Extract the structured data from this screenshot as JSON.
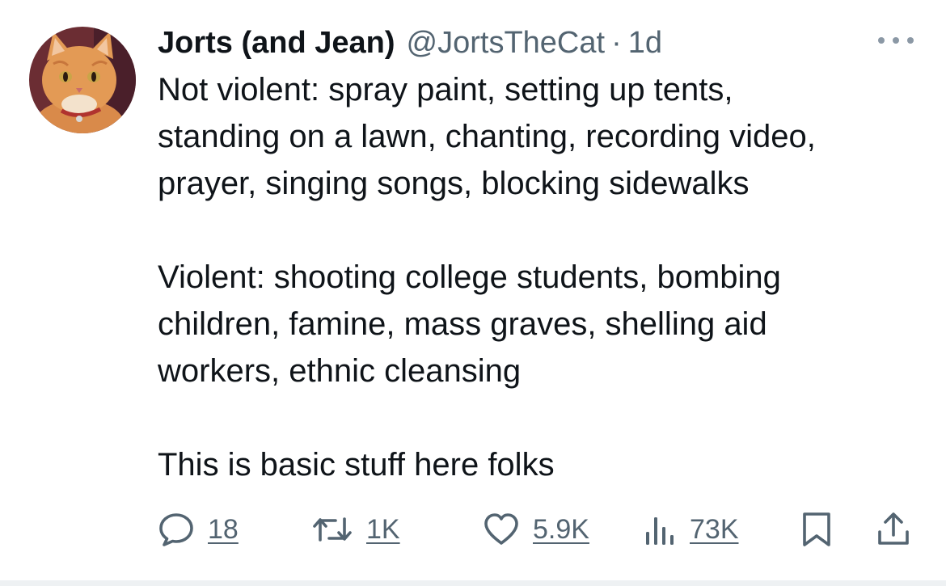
{
  "tweet": {
    "display_name": "Jorts (and Jean)",
    "handle": "@JortsTheCat",
    "separator": "·",
    "time": "1d",
    "avatar_icon": "orange-cat-avatar",
    "more_icon": "more-horizontal-icon",
    "text": {
      "line1": "Not violent: spray paint, setting up tents,",
      "line2": "standing on a lawn, chanting, recording video,",
      "line3": "prayer, singing songs, blocking sidewalks",
      "line4": "Violent: shooting college students, bombing",
      "line5": "children, famine, mass graves, shelling aid",
      "line6": "workers, ethnic cleansing",
      "line7": "This is basic stuff here folks"
    },
    "actions": {
      "replies": "18",
      "reposts": "1K",
      "likes": "5.9K",
      "views": "73K"
    },
    "colors": {
      "text": "#0f1419",
      "secondary": "#536471"
    }
  }
}
